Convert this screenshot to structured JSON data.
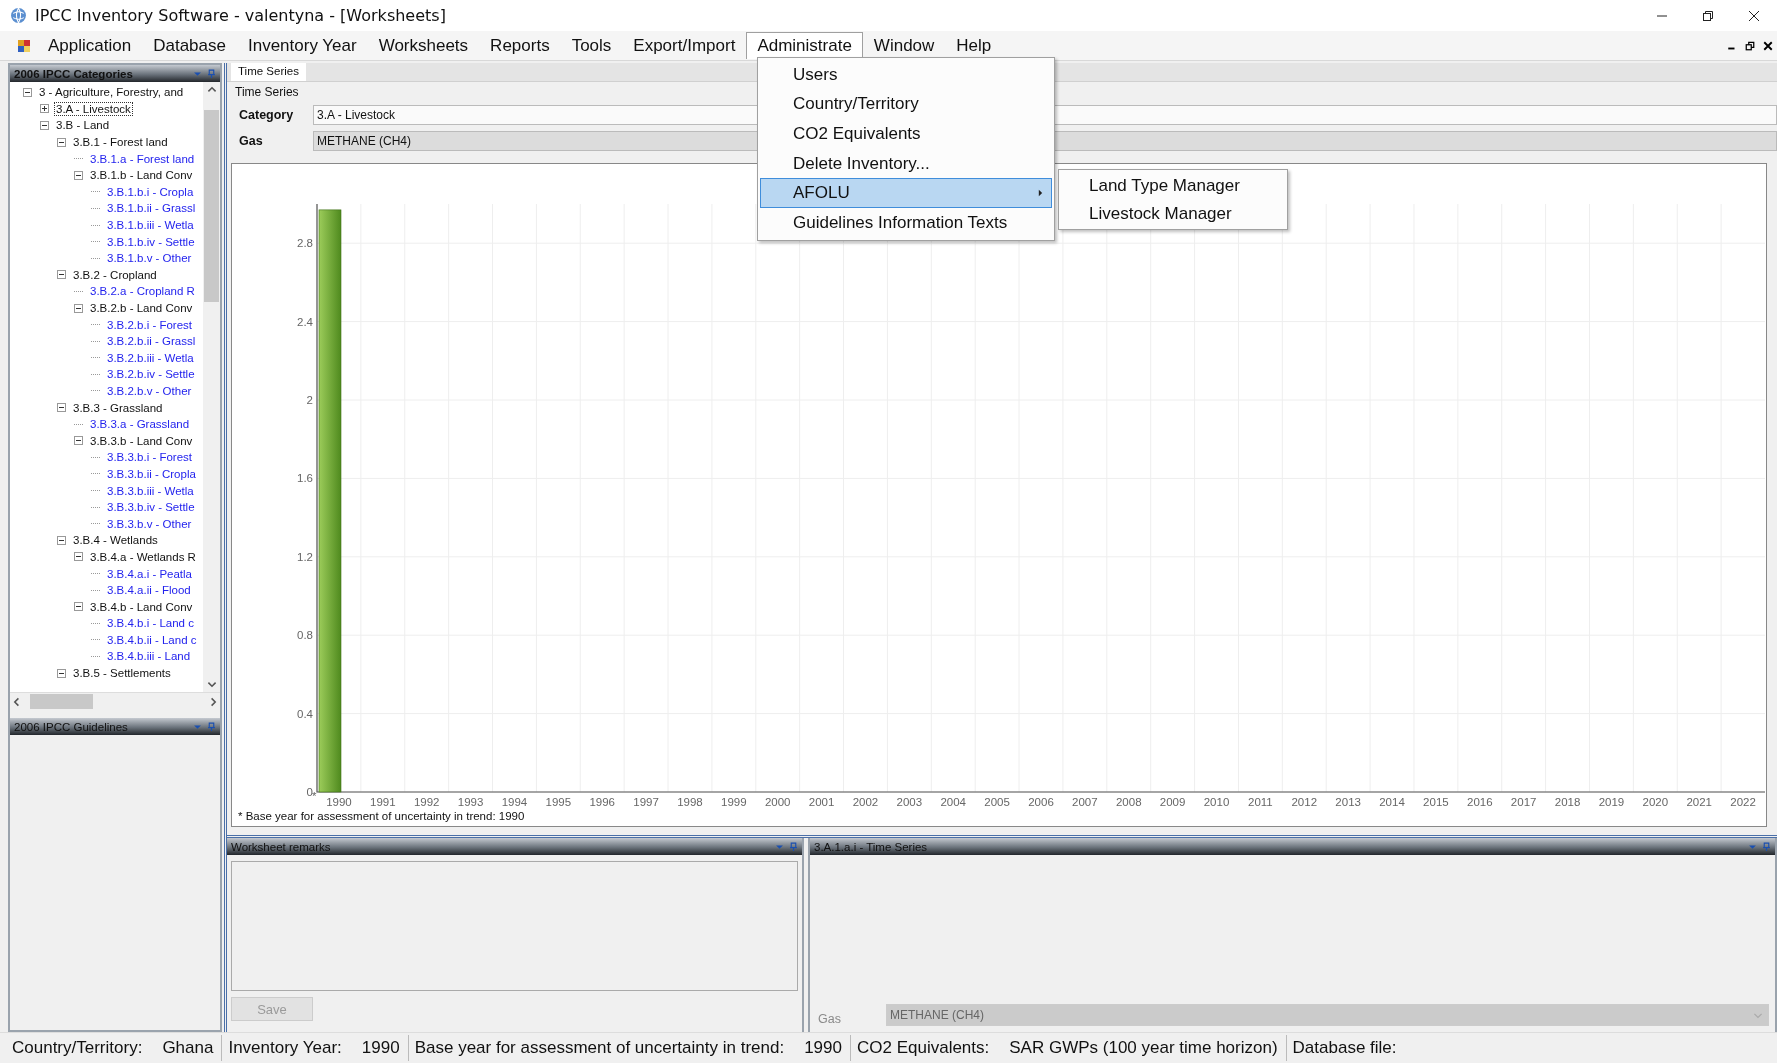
{
  "window": {
    "title": "IPCC Inventory Software - valentyna - [Worksheets]"
  },
  "menu_bar": {
    "items": [
      {
        "label": "Application",
        "selected": false
      },
      {
        "label": "Database",
        "selected": false
      },
      {
        "label": "Inventory Year",
        "selected": false
      },
      {
        "label": "Worksheets",
        "selected": false
      },
      {
        "label": "Reports",
        "selected": false
      },
      {
        "label": "Tools",
        "selected": false
      },
      {
        "label": "Export/Import",
        "selected": false
      },
      {
        "label": "Administrate",
        "selected": true
      },
      {
        "label": "Window",
        "selected": false
      },
      {
        "label": "Help",
        "selected": false
      }
    ]
  },
  "administrate_menu": {
    "items": [
      {
        "label": "Users",
        "selected": false,
        "has_submenu": false
      },
      {
        "label": "Country/Territory",
        "selected": false,
        "has_submenu": false
      },
      {
        "label": "CO2 Equivalents",
        "selected": false,
        "has_submenu": false
      },
      {
        "label": "Delete Inventory...",
        "selected": false,
        "has_submenu": false
      },
      {
        "label": "AFOLU",
        "selected": true,
        "has_submenu": true
      },
      {
        "label": "Guidelines Information Texts",
        "selected": false,
        "has_submenu": false
      }
    ]
  },
  "afolu_submenu": {
    "items": [
      "Land Type Manager",
      "Livestock Manager"
    ]
  },
  "categories_panel": {
    "title": "2006 IPCC Categories",
    "tree": [
      {
        "label": "3 - Agriculture, Forestry, and",
        "expanded": true,
        "selected": false,
        "children": [
          {
            "label": "3.A - Livestock",
            "expanded": false,
            "selected": true
          },
          {
            "label": "3.B - Land",
            "expanded": true,
            "selected": false,
            "children": [
              {
                "label": "3.B.1 - Forest land",
                "expanded": true,
                "selected": false,
                "children": [
                  {
                    "label": "3.B.1.a - Forest land",
                    "selected": false
                  },
                  {
                    "label": "3.B.1.b - Land Conv",
                    "expanded": true,
                    "selected": false,
                    "children": [
                      {
                        "label": "3.B.1.b.i - Cropla",
                        "selected": false
                      },
                      {
                        "label": "3.B.1.b.ii - Grassl",
                        "selected": false
                      },
                      {
                        "label": "3.B.1.b.iii - Wetla",
                        "selected": false
                      },
                      {
                        "label": "3.B.1.b.iv - Settle",
                        "selected": false
                      },
                      {
                        "label": "3.B.1.b.v - Other",
                        "selected": false
                      }
                    ]
                  }
                ]
              },
              {
                "label": "3.B.2 - Cropland",
                "expanded": true,
                "selected": false,
                "children": [
                  {
                    "label": "3.B.2.a - Cropland R",
                    "selected": false
                  },
                  {
                    "label": "3.B.2.b - Land Conv",
                    "expanded": true,
                    "selected": false,
                    "children": [
                      {
                        "label": "3.B.2.b.i - Forest",
                        "selected": false
                      },
                      {
                        "label": "3.B.2.b.ii - Grassl",
                        "selected": false
                      },
                      {
                        "label": "3.B.2.b.iii - Wetla",
                        "selected": false
                      },
                      {
                        "label": "3.B.2.b.iv - Settle",
                        "selected": false
                      },
                      {
                        "label": "3.B.2.b.v - Other",
                        "selected": false
                      }
                    ]
                  }
                ]
              },
              {
                "label": "3.B.3 - Grassland",
                "expanded": true,
                "selected": false,
                "children": [
                  {
                    "label": "3.B.3.a - Grassland",
                    "selected": false
                  },
                  {
                    "label": "3.B.3.b - Land Conv",
                    "expanded": true,
                    "selected": false,
                    "children": [
                      {
                        "label": "3.B.3.b.i - Forest",
                        "selected": false
                      },
                      {
                        "label": "3.B.3.b.ii - Cropla",
                        "selected": false
                      },
                      {
                        "label": "3.B.3.b.iii - Wetla",
                        "selected": false
                      },
                      {
                        "label": "3.B.3.b.iv - Settle",
                        "selected": false
                      },
                      {
                        "label": "3.B.3.b.v - Other",
                        "selected": false
                      }
                    ]
                  }
                ]
              },
              {
                "label": "3.B.4 - Wetlands",
                "expanded": true,
                "selected": false,
                "children": [
                  {
                    "label": "3.B.4.a - Wetlands R",
                    "expanded": true,
                    "selected": false,
                    "children": [
                      {
                        "label": "3.B.4.a.i - Peatla",
                        "selected": false
                      },
                      {
                        "label": "3.B.4.a.ii - Flood",
                        "selected": false
                      }
                    ]
                  },
                  {
                    "label": "3.B.4.b - Land Conv",
                    "expanded": true,
                    "selected": false,
                    "children": [
                      {
                        "label": "3.B.4.b.i - Land c",
                        "selected": false
                      },
                      {
                        "label": "3.B.4.b.ii - Land c",
                        "selected": false
                      },
                      {
                        "label": "3.B.4.b.iii - Land",
                        "selected": false
                      }
                    ]
                  }
                ]
              },
              {
                "label": "3.B.5 - Settlements",
                "expanded": true,
                "selected": false
              }
            ]
          }
        ]
      }
    ]
  },
  "guidelines_panel": {
    "title": "2006 IPCC Guidelines"
  },
  "worksheet": {
    "tabs": [
      {
        "label": "Time Series",
        "selected": true
      }
    ],
    "group_title": "Time Series",
    "category": {
      "label": "Category",
      "value": "3.A - Livestock"
    },
    "gas": {
      "label": "Gas",
      "value": "METHANE (CH4)"
    },
    "chart_data": {
      "type": "bar",
      "categories": [
        "1990",
        "1991",
        "1992",
        "1993",
        "1994",
        "1995",
        "1996",
        "1997",
        "1998",
        "1999",
        "2000",
        "2001",
        "2002",
        "2003",
        "2004",
        "2005",
        "2006",
        "2007",
        "2008",
        "2009",
        "2010",
        "2011",
        "2012",
        "2013",
        "2014",
        "2015",
        "2016",
        "2017",
        "2018",
        "2019",
        "2020",
        "2021",
        "2022"
      ],
      "values": [
        2.97,
        null,
        null,
        null,
        null,
        null,
        null,
        null,
        null,
        null,
        null,
        null,
        null,
        null,
        null,
        null,
        null,
        null,
        null,
        null,
        null,
        null,
        null,
        null,
        null,
        null,
        null,
        null,
        null,
        null,
        null,
        null,
        null
      ],
      "grid": true,
      "ylim": [
        0,
        3
      ],
      "yticks": [
        0,
        0.4,
        0.8,
        1.2,
        1.6,
        2,
        2.4,
        2.8
      ]
    },
    "base_year_mark": "*",
    "footnote": "* Base year for assessment of uncertainty in trend: 1990"
  },
  "remarks_panel": {
    "title": "Worksheet remarks",
    "save_button": {
      "label": "Save",
      "disabled": true
    }
  },
  "time_series_panel": {
    "title": "3.A.1.a.i - Time Series",
    "gas": {
      "label": "Gas",
      "value": "METHANE (CH4)",
      "disabled": true
    }
  },
  "status_bar": [
    {
      "label": "Country/Territory:",
      "value": "Ghana"
    },
    {
      "label": "Inventory Year:",
      "value": "1990"
    },
    {
      "label": "Base year for assessment of uncertainty in trend:",
      "value": "1990"
    },
    {
      "label": "CO2 Equivalents:",
      "value": "SAR GWPs (100 year time horizon)"
    },
    {
      "label": "Database file:"
    }
  ]
}
